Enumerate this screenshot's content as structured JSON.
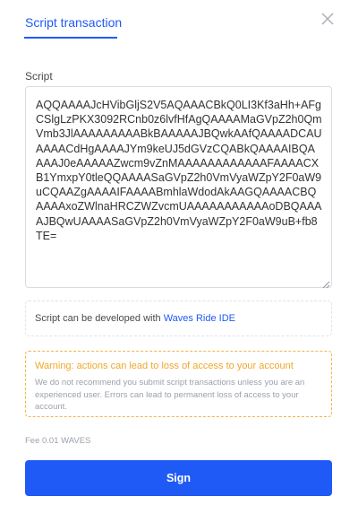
{
  "header": {
    "tab_label": "Script transaction",
    "close_icon": "close-icon"
  },
  "script": {
    "label": "Script",
    "value": "AQQAAAAJcHVibGljS2V5AQAAACBkQ0LI3Kf3aHh+AFgCSlgLzPKX3092RCnb0z6lvfHfAgQAAAAMaGVpZ2h0QmVmb3JlAAAAAAAAABkBAAAAAJBQwkAAfQAAAADCAUAAAACdHgAAAAJYm9keUJ5dGVzCQABkQAAAAIBQAAAAJ0eAAAAAZwcm9vZnMAAAAAAAAAAAAFAAAACXB1YmxpY0tleQQAAAASaGVpZ2h0VmVyaWZpY2F0aW9uCQAAZgAAAAIFAAAABmhlaWdodAkAAGQAAAACBQAAAAxoZWlnaHRCZWZvcmUAAAAAAAAAAAoDBQAAAAJBQwUAAAASaGVpZ2h0VmVyaWZpY2F0aW9uB+fb8TE="
  },
  "ide": {
    "text": "Script can be developed with",
    "link": "Waves Ride IDE"
  },
  "warning": {
    "title": "Warning: actions can lead to loss of access to your account",
    "text": "We do not recommend you submit script transactions unless you are an experienced user. Errors can lead to permanent loss of access to your account."
  },
  "fee": {
    "text": "Fee 0.01 WAVES"
  },
  "actions": {
    "sign_label": "Sign"
  },
  "colors": {
    "accent": "#1f5af6",
    "warning": "#f0a72a",
    "muted": "#9ba1aa"
  }
}
